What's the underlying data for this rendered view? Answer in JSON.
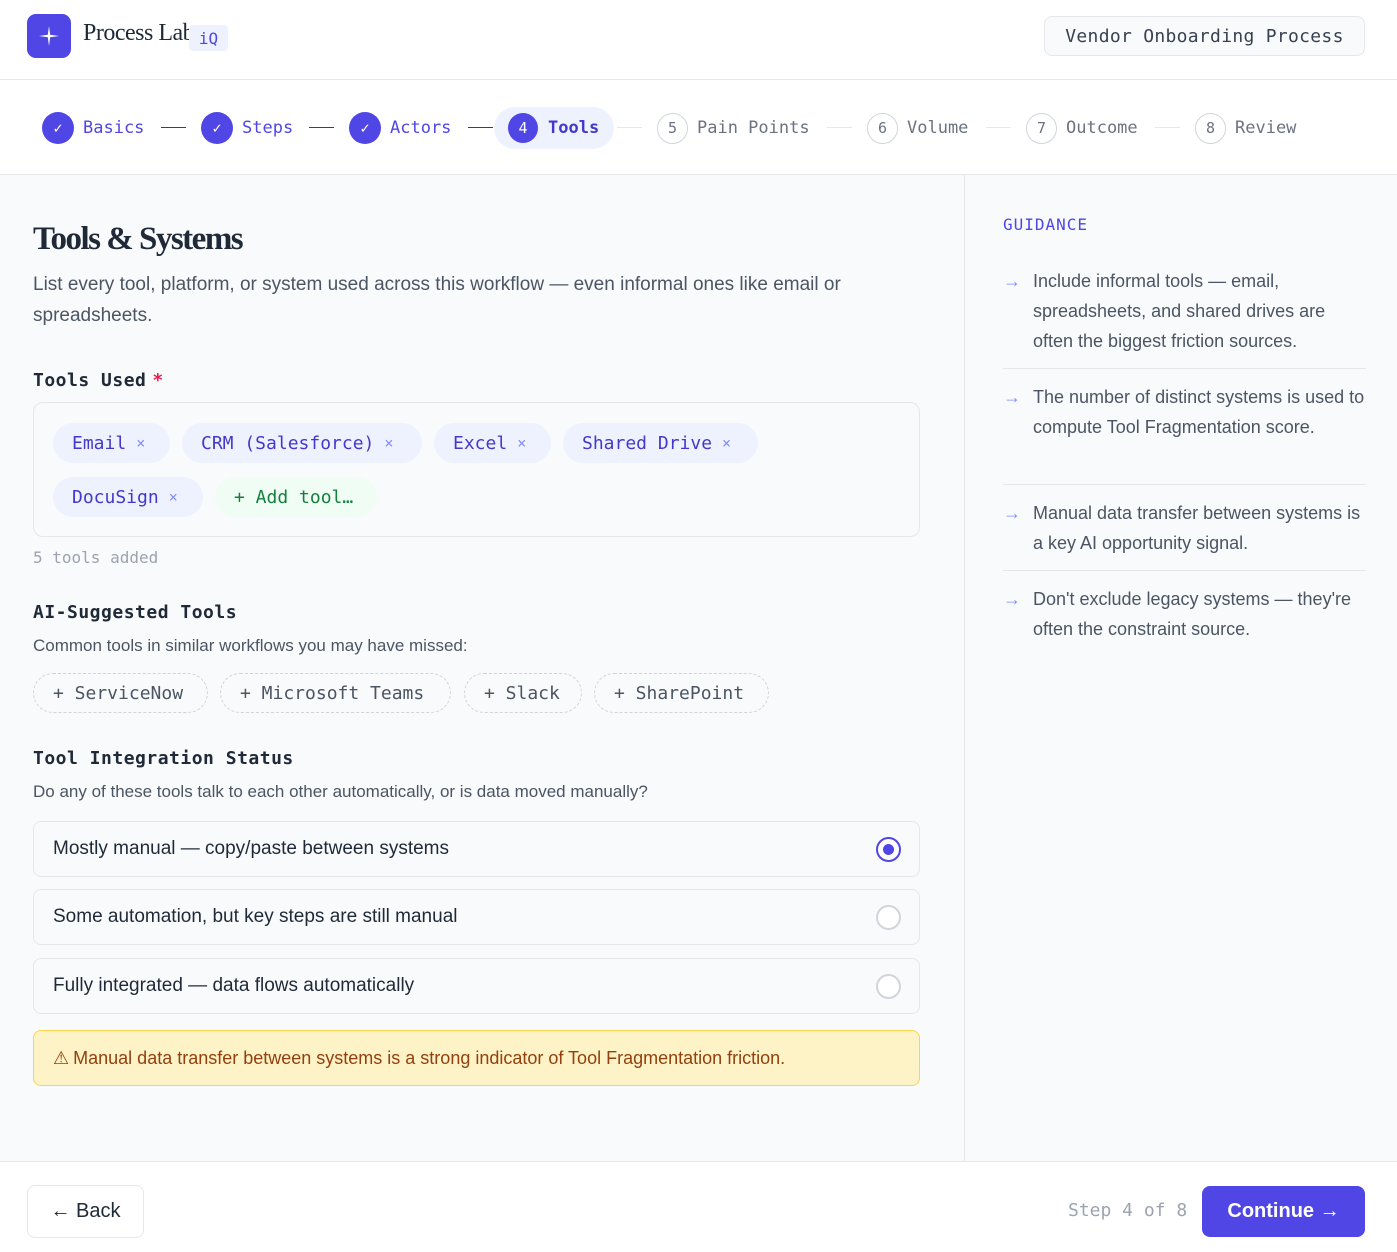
{
  "header": {
    "brand": "Process Lab",
    "brand_badge": "iQ",
    "process_name": "Vendor Onboarding Process"
  },
  "stepper": {
    "steps": [
      {
        "num": "✓",
        "label": "Basics",
        "state": "done"
      },
      {
        "num": "✓",
        "label": "Steps",
        "state": "done"
      },
      {
        "num": "✓",
        "label": "Actors",
        "state": "done"
      },
      {
        "num": "4",
        "label": "Tools",
        "state": "active"
      },
      {
        "num": "5",
        "label": "Pain Points",
        "state": "todo"
      },
      {
        "num": "6",
        "label": "Volume",
        "state": "todo"
      },
      {
        "num": "7",
        "label": "Outcome",
        "state": "todo"
      },
      {
        "num": "8",
        "label": "Review",
        "state": "todo"
      }
    ]
  },
  "main": {
    "title": "Tools & Systems",
    "description": "List every tool, platform, or system used across this workflow — even informal ones like email or spreadsheets.",
    "tools_used_label": "Tools Used",
    "required_mark": "*",
    "tools": [
      "Email",
      "CRM (Salesforce)",
      "Excel",
      "Shared Drive",
      "DocuSign"
    ],
    "remove_glyph": "×",
    "add_tool_label": "+ Add tool…",
    "tools_count": "5 tools added",
    "suggested_label": "AI-Suggested Tools",
    "suggested_desc": "Common tools in similar workflows you may have missed:",
    "suggested": [
      "+ ServiceNow",
      "+ Microsoft Teams",
      "+ Slack",
      "+ SharePoint"
    ],
    "integration_label": "Tool Integration Status",
    "integration_desc": "Do any of these tools talk to each other automatically, or is data moved manually?",
    "integration_options": [
      {
        "label": "Mostly manual — copy/paste between systems",
        "selected": true
      },
      {
        "label": "Some automation, but key steps are still manual",
        "selected": false
      },
      {
        "label": "Fully integrated — data flows automatically",
        "selected": false
      }
    ],
    "warning_icon": "⚠",
    "warning": "Manual data transfer between systems is a strong indicator of Tool Fragmentation friction."
  },
  "guidance": {
    "title": "GUIDANCE",
    "arrow": "→",
    "items": [
      "Include informal tools — email, spreadsheets, and shared drives are often the biggest friction sources.",
      "The number of distinct systems is used to compute Tool Fragmentation score.",
      "Manual data transfer between systems is a key AI opportunity signal.",
      "Don't exclude legacy systems — they're often the constraint source."
    ]
  },
  "footer": {
    "back_label": "← Back",
    "step_count": "Step 4 of 8",
    "continue_label": "Continue →"
  },
  "colors": {
    "accent": "#4f46e5",
    "chip_bg": "#eef2ff",
    "add_chip": "#15803d",
    "warning_bg": "#fef3c7",
    "warning_text": "#92400e"
  }
}
